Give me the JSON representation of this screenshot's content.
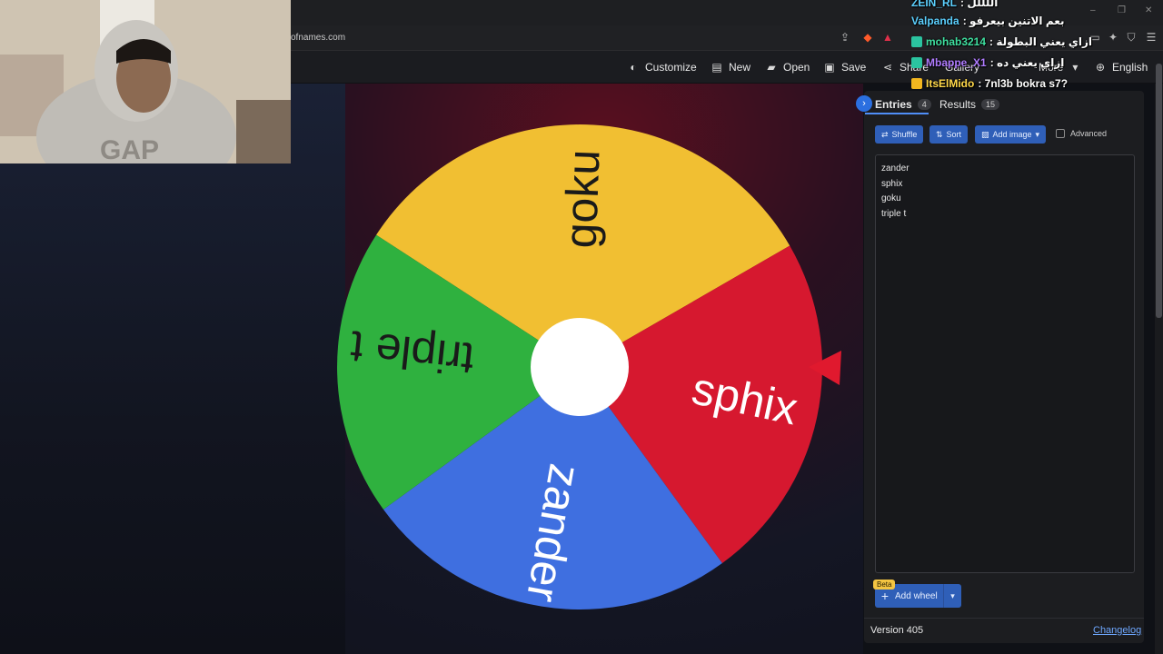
{
  "browser": {
    "address": "ofnames.com",
    "window_controls": [
      "–",
      "❐",
      "✕"
    ]
  },
  "toolbar": {
    "customize": "Customize",
    "new": "New",
    "open": "Open",
    "save": "Save",
    "share": "Share",
    "gallery": "Gallery",
    "more": "More",
    "language": "English"
  },
  "wheel": {
    "segments": [
      {
        "label": "goku",
        "color": "#f1bf32"
      },
      {
        "label": "sphix",
        "color": "#d6182f"
      },
      {
        "label": "zander",
        "color": "#3f6fe0"
      },
      {
        "label": "triple t",
        "color": "#2fb13f"
      }
    ],
    "pointer_color": "#e0192e"
  },
  "panel": {
    "tabs": [
      {
        "label": "Entries",
        "count": "4"
      },
      {
        "label": "Results",
        "count": "15"
      }
    ],
    "buttons": {
      "shuffle": "Shuffle",
      "sort": "Sort",
      "add_image": "Add image",
      "advanced": "Advanced"
    },
    "entries": [
      "zander",
      "sphix",
      "goku",
      "triple t"
    ],
    "add_wheel": "Add wheel",
    "beta": "Beta",
    "version": "Version 405",
    "changelog": "Changelog"
  },
  "chat": [
    {
      "user": "ZEIN_RL",
      "message": ": اللللل",
      "color": "#5cd0ff"
    },
    {
      "user": "Valpanda",
      "message": ": بعم الاتنين بيعرفو",
      "color": "#5cd0ff"
    },
    {
      "user": "mohab3214",
      "message": ": ازاي يعني البطولة",
      "color": "#3fe0a0"
    },
    {
      "user": "Mbappe_X1",
      "message": ": ازاي يعني ده",
      "color": "#b07cff"
    },
    {
      "user": "ItsElMido",
      "message": ": 7nl3b bokra s7?",
      "color": "#ffd84a"
    }
  ],
  "colors": {
    "accent": "#2f5fb8",
    "panel_bg": "#1c1d20"
  }
}
